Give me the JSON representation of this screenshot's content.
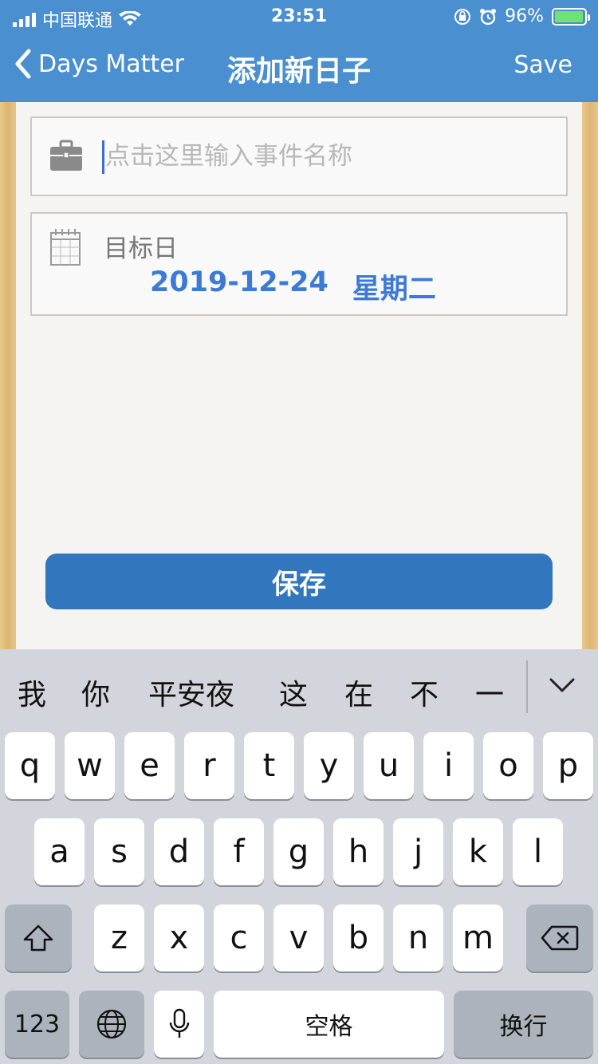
{
  "status": {
    "carrier": "中国联通",
    "time": "23:51",
    "battery": "96%",
    "battery_level": 0.96
  },
  "nav": {
    "back_label": "Days Matter",
    "title": "添加新日子",
    "save_label": "Save"
  },
  "form": {
    "name_placeholder": "点击这里输入事件名称",
    "date_label": "目标日",
    "date_value": "2019-12-24",
    "weekday": "星期二",
    "save_button": "保存"
  },
  "keyboard": {
    "candidates": [
      "我",
      "你",
      "平安夜",
      "这",
      "在",
      "不",
      "一"
    ],
    "row1": [
      "q",
      "w",
      "e",
      "r",
      "t",
      "y",
      "u",
      "i",
      "o",
      "p"
    ],
    "row2": [
      "a",
      "s",
      "d",
      "f",
      "g",
      "h",
      "j",
      "k",
      "l"
    ],
    "row3": [
      "z",
      "x",
      "c",
      "v",
      "b",
      "n",
      "m"
    ],
    "numbers_key": "123",
    "space_key": "空格",
    "return_key": "换行"
  },
  "colors": {
    "nav_bar": "#4a8fd0",
    "accent_date": "#3d7ad6",
    "save_button": "#3277bd",
    "keyboard_bg": "#d2d5db"
  },
  "icons": {
    "status": [
      "signal-icon",
      "wifi-icon",
      "orientation-lock-icon",
      "alarm-icon",
      "battery-icon"
    ],
    "nav": [
      "chevron-left-icon"
    ],
    "form": [
      "briefcase-icon",
      "calendar-icon"
    ],
    "keyboard": [
      "chevron-down-icon",
      "shift-icon",
      "backspace-icon",
      "globe-icon",
      "microphone-icon"
    ]
  }
}
